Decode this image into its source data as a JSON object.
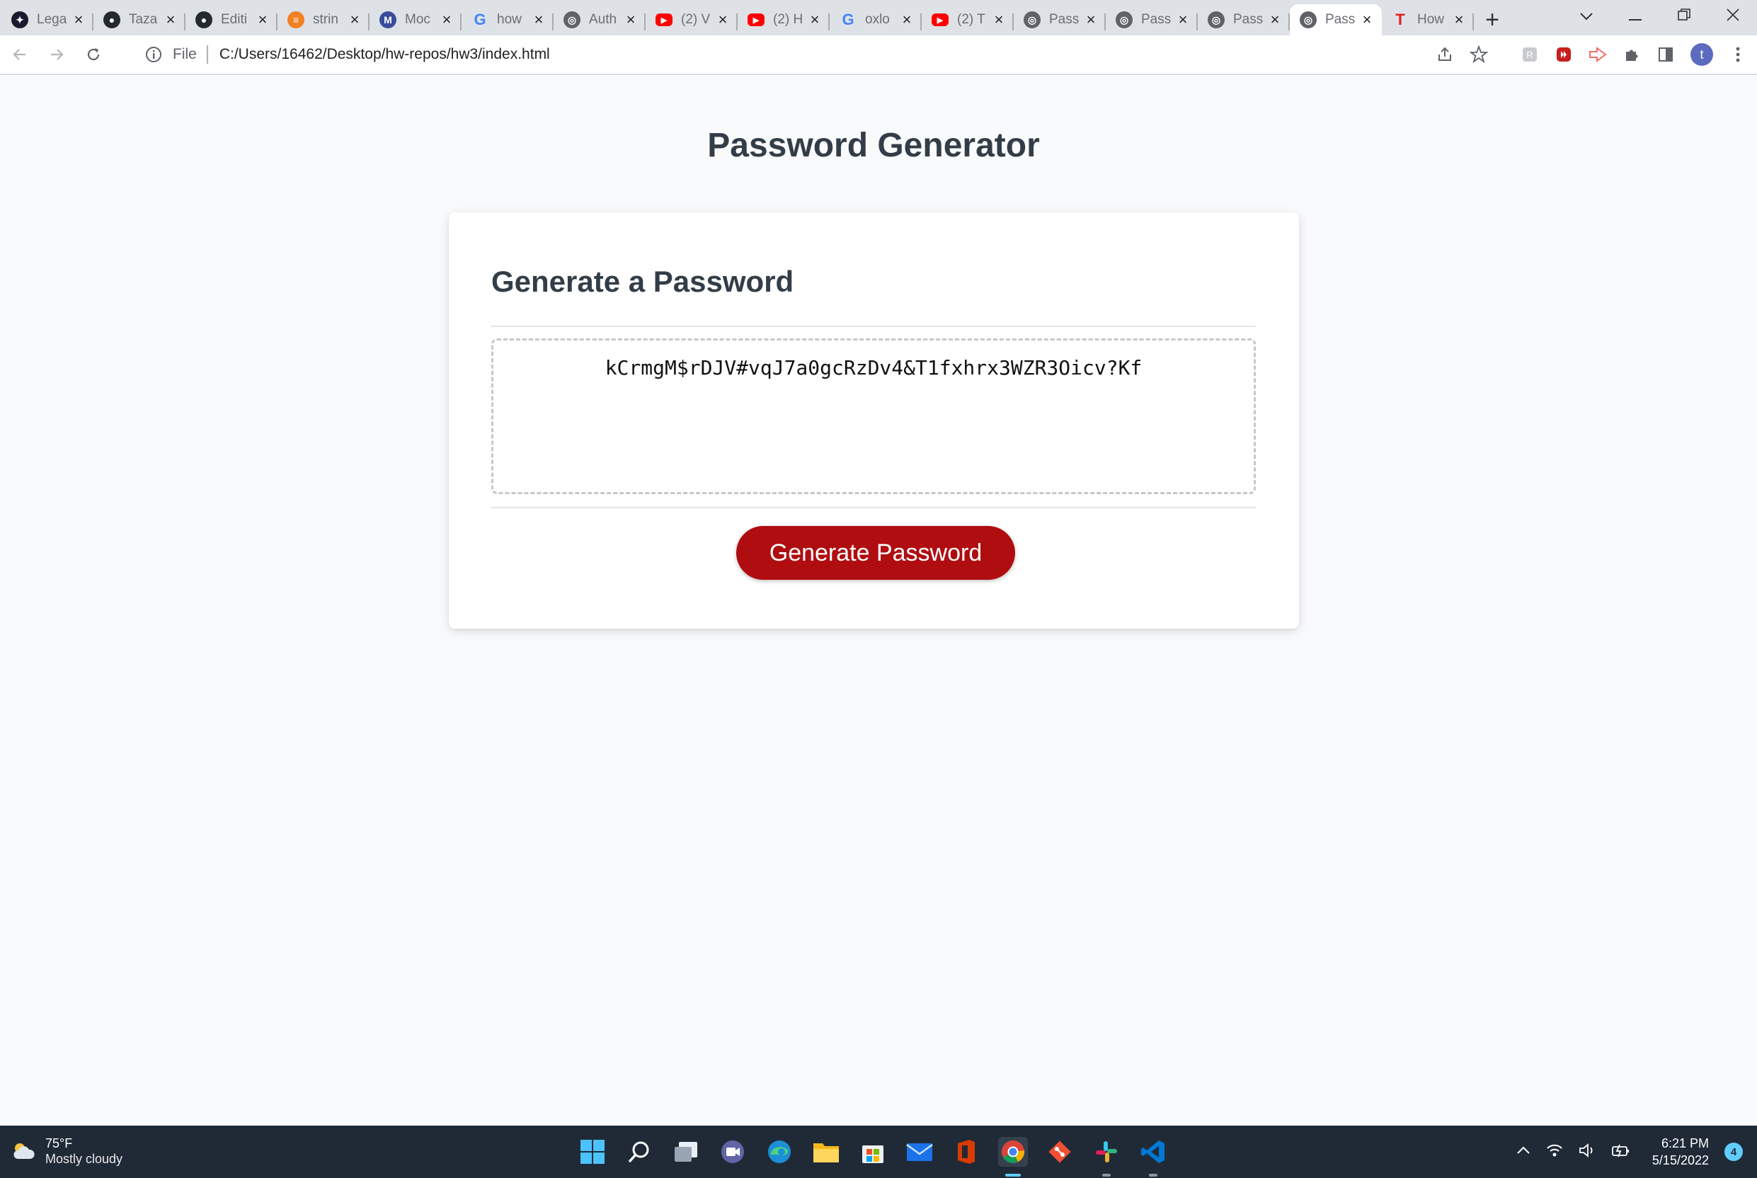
{
  "browser": {
    "tabs": [
      {
        "title": "Lega",
        "icon": "codewars-icon",
        "color": "#1a1a2e"
      },
      {
        "title": "Taza",
        "icon": "github-icon",
        "color": "#24292f"
      },
      {
        "title": "Editi",
        "icon": "github-icon",
        "color": "#24292f"
      },
      {
        "title": "strin",
        "icon": "stackoverflow-icon",
        "color": "#f48024"
      },
      {
        "title": "Moc",
        "icon": "mock-icon",
        "color": "#3a4d9c"
      },
      {
        "title": "how",
        "icon": "google-icon",
        "color": "#4285f4"
      },
      {
        "title": "Auth",
        "icon": "globe-icon",
        "color": "#5f6368"
      },
      {
        "title": "(2) V",
        "icon": "youtube-icon",
        "color": "#ff0000"
      },
      {
        "title": "(2) H",
        "icon": "youtube-icon",
        "color": "#ff0000"
      },
      {
        "title": "oxlo",
        "icon": "google-icon",
        "color": "#4285f4"
      },
      {
        "title": "(2) T",
        "icon": "youtube-icon",
        "color": "#ff0000"
      },
      {
        "title": "Pass",
        "icon": "globe-icon",
        "color": "#5f6368"
      },
      {
        "title": "Pass",
        "icon": "globe-icon",
        "color": "#5f6368"
      },
      {
        "title": "Pass",
        "icon": "globe-icon",
        "color": "#5f6368"
      },
      {
        "title": "Pass",
        "icon": "globe-icon",
        "color": "#5f6368",
        "active": true
      },
      {
        "title": "How",
        "icon": "t-icon",
        "color": "#e02020"
      }
    ],
    "address": {
      "scheme_label": "File",
      "url": "C:/Users/16462/Desktop/hw-repos/hw3/index.html"
    },
    "profile_initial": "t"
  },
  "page": {
    "title": "Password Generator",
    "card_heading": "Generate a Password",
    "password": "kCrmgM$rDJV#vqJ7a0gcRzDv4&T1fxhrx3WZR3Oicv?Kf",
    "button_label": "Generate Password",
    "accent_color": "#b00d11"
  },
  "taskbar": {
    "weather_temp": "75°F",
    "weather_condition": "Mostly cloudy",
    "time": "6:21 PM",
    "date": "5/15/2022",
    "notification_count": "4"
  }
}
